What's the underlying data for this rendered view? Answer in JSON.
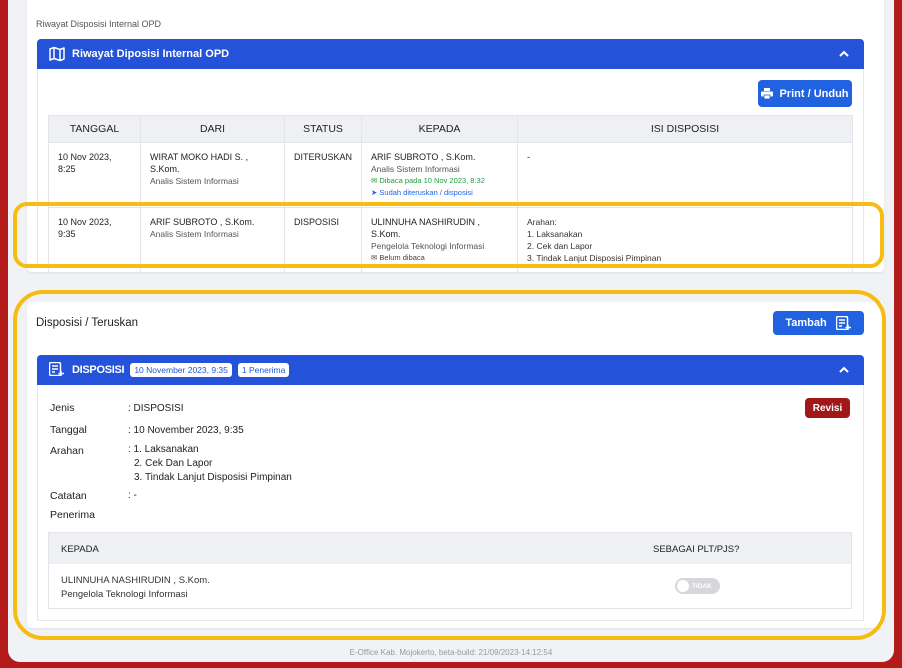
{
  "breadcrumb": "Riwayat Disposisi Internal OPD",
  "history": {
    "title": "Riwayat Diposisi Internal OPD",
    "print_label": "Print / Unduh",
    "columns": [
      "TANGGAL",
      "DARI",
      "STATUS",
      "KEPADA",
      "ISI DISPOSISI"
    ],
    "rows": [
      {
        "tanggal": "10 Nov 2023, 8:25",
        "dari_nama": "WIRAT MOKO HADI S. , S.Kom.",
        "dari_jabatan": "Analis Sistem Informasi",
        "status": "DITERUSKAN",
        "kepada_nama": "ARIF SUBROTO , S.Kom.",
        "kepada_jabatan": "Analis Sistem Informasi",
        "kepada_note1": "Dibaca pada 10 Nov 2023, 8:32",
        "kepada_note2": "Sudah diteruskan / disposisi",
        "isi": "-"
      },
      {
        "tanggal": "10 Nov 2023, 9:35",
        "dari_nama": "ARIF SUBROTO , S.Kom.",
        "dari_jabatan": "Analis Sistem Informasi",
        "status": "DISPOSISI",
        "kepada_nama": "ULINNUHA NASHIRUDIN , S.Kom.",
        "kepada_jabatan": "Pengelola Teknologi Informasi",
        "kepada_note1": "Belum dibaca",
        "isi_title": "Arahan:",
        "isi_lines": [
          "1. Laksanakan",
          "2. Cek dan Lapor",
          "3. Tindak Lanjut Disposisi Pimpinan"
        ]
      }
    ]
  },
  "disposisi": {
    "section_title": "Disposisi / Teruskan",
    "tambah_label": "Tambah",
    "header_label": "DISPOSISI",
    "badge_date": "10 November 2023, 9:35",
    "badge_count": "1 Penerima",
    "revisi_label": "Revisi",
    "fields": {
      "jenis_label": "Jenis",
      "jenis_value": ": DISPOSISI",
      "tanggal_label": "Tanggal",
      "tanggal_value": ": 10 November 2023, 9:35",
      "arahan_label": "Arahan",
      "arahan_lines": [
        ": 1. Laksanakan",
        "2. Cek Dan Lapor",
        "3. Tindak Lanjut Disposisi Pimpinan"
      ],
      "catatan_label": "Catatan",
      "catatan_value": ": -",
      "penerima_label": "Penerima"
    },
    "recipients": {
      "col_kepada": "KEPADA",
      "col_plt": "SEBAGAI PLT/PJS?",
      "rows": [
        {
          "nama": "ULINNUHA NASHIRUDIN , S.Kom.",
          "jabatan": "Pengelola Teknologi Informasi",
          "toggle": "TIDAK",
          "toggle_on": false
        }
      ]
    }
  },
  "footer": "E-Office Kab. Mojokerto, beta-build: 21/09/2023-14:12:54",
  "colors": {
    "primary": "#2453d9",
    "button": "#2062e0",
    "danger": "#a01818",
    "highlight": "#f7bc12",
    "frame": "#b31b1b"
  }
}
